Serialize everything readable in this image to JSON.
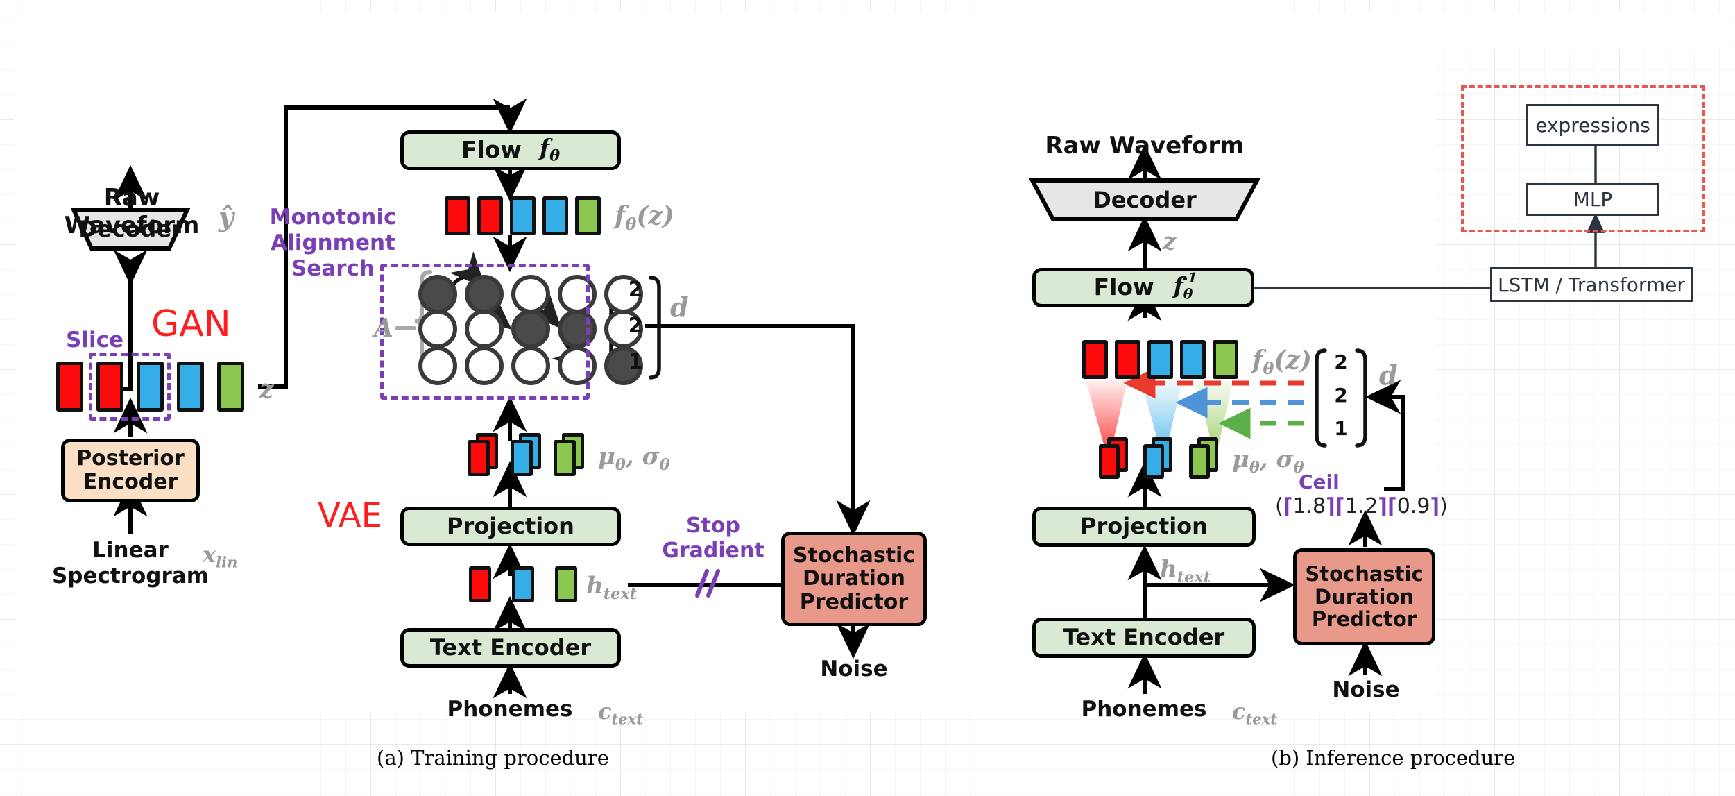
{
  "figure": {
    "panels": [
      {
        "id": "a",
        "caption": "(a) Training procedure"
      },
      {
        "id": "b",
        "caption": "(b) Inference procedure"
      }
    ]
  },
  "colors": {
    "token_red": "#fb0b0b",
    "token_blue": "#35aee8",
    "token_green": "#8cc74f",
    "box_green": "#dae9d3",
    "box_peach": "#fadfc5",
    "box_salmon": "#e8998a",
    "box_gray": "#e6e6e6",
    "purple": "#7b3fb5",
    "gan_red": "#ff1d1d",
    "dashed_red": "#e8564f",
    "symbol_gray": "#9a9a9a"
  },
  "training": {
    "raw_waveform_label": "Raw\nWaveform",
    "raw_waveform_line1": "Raw",
    "raw_waveform_line2": "Waveform",
    "y_hat_symbol": "ŷ",
    "decoder_label": "Decoder",
    "gan_label": "GAN",
    "slice_label": "Slice",
    "z_symbol": "z",
    "posterior_encoder_line1": "Posterior",
    "posterior_encoder_line2": "Encoder",
    "linear_spectrogram_line1": "Linear",
    "linear_spectrogram_line2": "Spectrogram",
    "x_lin_symbol": "x_lin",
    "flow_label": "Flow",
    "flow_symbol": "f_θ",
    "fz_symbol": "f_θ(z)",
    "mas_line1": "Monotonic",
    "mas_line2": "Alignment",
    "mas_line3": "Search",
    "matrix_label": "A",
    "d_symbol": "d",
    "d_values": [
      "2",
      "2",
      "1"
    ],
    "alignment_matrix": [
      [
        1,
        1,
        0,
        0,
        0
      ],
      [
        0,
        0,
        1,
        1,
        0
      ],
      [
        0,
        0,
        0,
        0,
        1
      ]
    ],
    "mu_sigma_symbol": "μ_θ, σ_θ",
    "projection_label": "Projection",
    "vae_label": "VAE",
    "h_text_symbol": "h_text",
    "stop_gradient_line1": "Stop",
    "stop_gradient_line2": "Gradient",
    "sdp_line1": "Stochastic",
    "sdp_line2": "Duration",
    "sdp_line3": "Predictor",
    "noise_label": "Noise",
    "text_encoder_label": "Text Encoder",
    "phonemes_label": "Phonemes",
    "c_text_symbol": "c_text",
    "latent_tokens": [
      "red",
      "red",
      "blue",
      "blue",
      "green"
    ],
    "htext_tokens": [
      "red",
      "blue",
      "green"
    ],
    "musigma_tokens": [
      "red",
      "blue",
      "green"
    ]
  },
  "inference": {
    "raw_waveform_label": "Raw Waveform",
    "decoder_label": "Decoder",
    "z_symbol": "z",
    "flow_label": "Flow",
    "flow_symbol": "f_θ⁻¹",
    "fz_symbol": "f_θ(z)",
    "mu_sigma_symbol": "μ_θ, σ_θ",
    "d_symbol": "d",
    "d_values": [
      "2",
      "2",
      "1"
    ],
    "ceil_label": "Ceil",
    "ceil_expression": "(⌈1.8⌉⌈1.2⌉⌈0.9⌉)",
    "ceil_values": [
      "1.8",
      "1.2",
      "0.9"
    ],
    "projection_label": "Projection",
    "h_text_symbol": "h_text",
    "text_encoder_label": "Text Encoder",
    "phonemes_label": "Phonemes",
    "c_text_symbol": "c_text",
    "sdp_line1": "Stochastic",
    "sdp_line2": "Duration",
    "sdp_line3": "Predictor",
    "noise_label": "Noise",
    "latent_tokens": [
      "red",
      "red",
      "blue",
      "blue",
      "green"
    ],
    "musigma_tokens": [
      "red",
      "blue",
      "green"
    ]
  },
  "expression_module": {
    "expressions_label": "expressions",
    "mlp_label": "MLP",
    "lstm_transformer_label": "LSTM / Transformer"
  }
}
